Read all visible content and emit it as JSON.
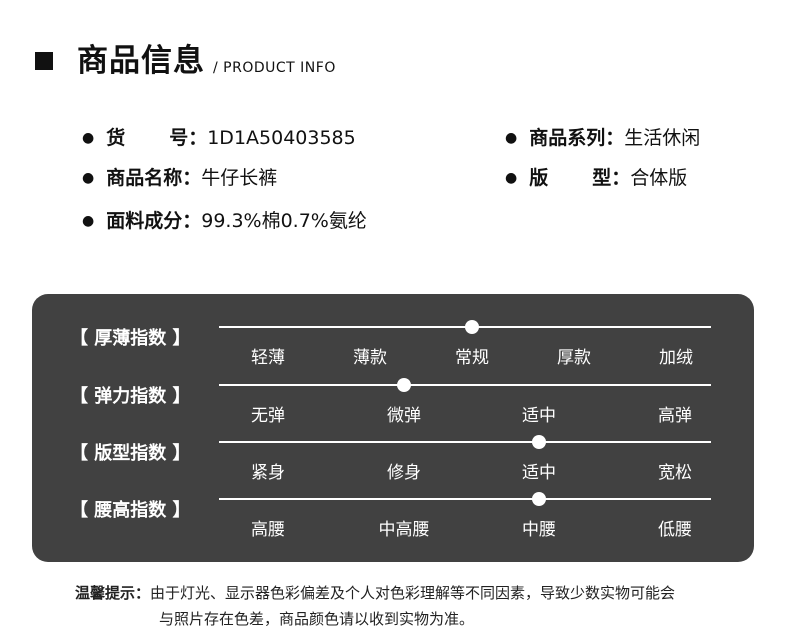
{
  "header": {
    "title": "商品信息",
    "subtitle": "/ PRODUCT INFO"
  },
  "specs": {
    "item_no": {
      "label": [
        "货",
        "号："
      ],
      "value": "1D1A50403585"
    },
    "name": {
      "label": "商品名称：",
      "value": "牛仔长裤"
    },
    "fabric": {
      "label": "面料成分：",
      "value": "99.3%棉0.7%氨纶"
    },
    "series": {
      "label": "商品系列：",
      "value": "生活休闲"
    },
    "fit": {
      "label": [
        "版",
        "型："
      ],
      "value": "合体版"
    }
  },
  "indices": [
    {
      "label": "【 厚薄指数 】",
      "options": [
        "轻薄",
        "薄款",
        "常规",
        "厚款",
        "加绒"
      ],
      "selected_index": 2
    },
    {
      "label": "【 弹力指数 】",
      "options": [
        "无弹",
        "微弹",
        "适中",
        "高弹"
      ],
      "selected_index": 1
    },
    {
      "label": "【 版型指数 】",
      "options": [
        "紧身",
        "修身",
        "适中",
        "宽松"
      ],
      "selected_index": 2
    },
    {
      "label": "【 腰高指数 】",
      "options": [
        "高腰",
        "中高腰",
        "中腰",
        "低腰"
      ],
      "selected_index": 2
    }
  ],
  "note": {
    "label": "温馨提示：",
    "line1": "由于灯光、显示器色彩偏差及个人对色彩理解等不同因素，导致少数实物可能会",
    "line2": "与照片存在色差，商品颜色请以收到实物为准。"
  }
}
